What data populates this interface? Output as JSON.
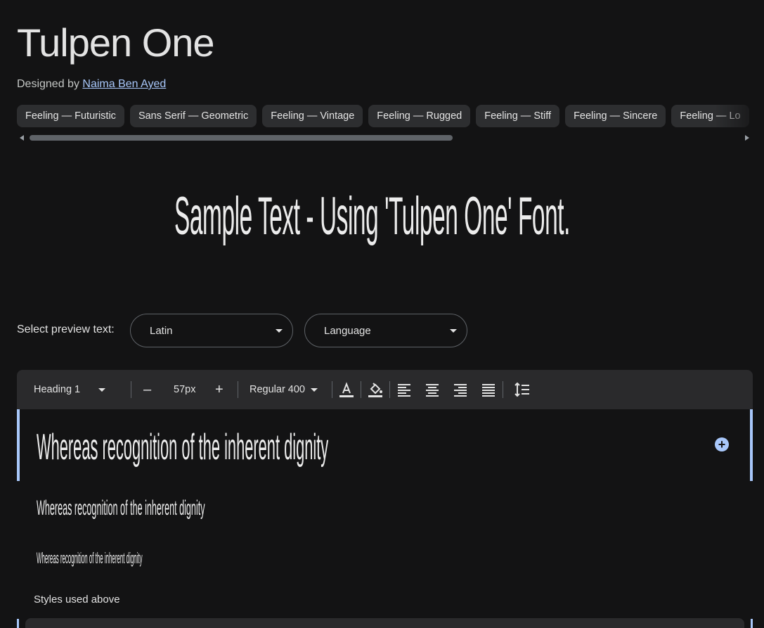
{
  "font": {
    "name": "Tulpen One",
    "designed_by_label": "Designed by",
    "designer": "Naima Ben Ayed"
  },
  "tags": [
    "Feeling — Futuristic",
    "Sans Serif — Geometric",
    "Feeling — Vintage",
    "Feeling — Rugged",
    "Feeling — Stiff",
    "Feeling — Sincere",
    "Feeling — Lo"
  ],
  "hero": {
    "sample_text": "Sample Text - Using 'Tulpen One' Font."
  },
  "preview": {
    "label": "Select preview text:",
    "script_select": "Latin",
    "language_select": "Language"
  },
  "toolbar": {
    "style_select": "Heading 1",
    "decrease": "–",
    "size": "57px",
    "increase": "+",
    "weight_select": "Regular 400"
  },
  "samples": [
    "Whereas recognition of the inherent dignity",
    "Whereas recognition of the inherent dignity",
    "Whereas recognition of the inherent dignity"
  ],
  "styles_used_label": "Styles used above",
  "colors": {
    "accent": "#a8c7fa",
    "background": "#131314",
    "toolbar": "#2a2a2c",
    "chip": "#2d2e30"
  }
}
